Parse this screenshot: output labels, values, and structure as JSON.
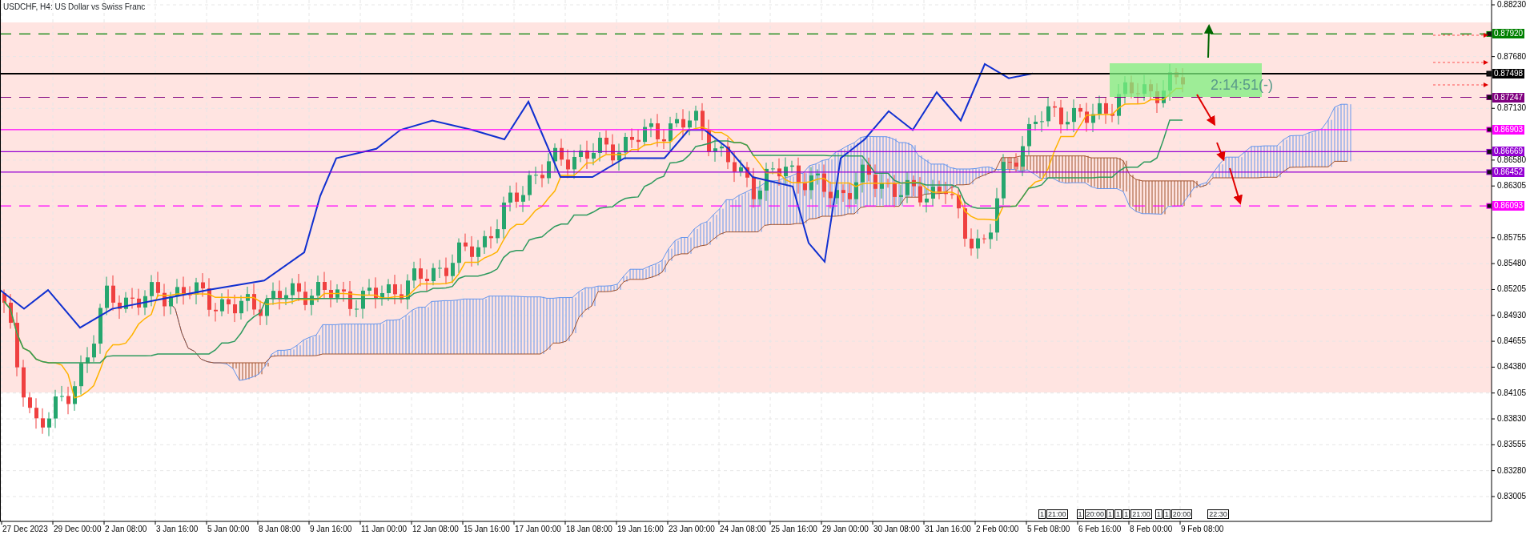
{
  "chart": {
    "title": "USDCHF, H4:  US Dollar vs Swiss Franc",
    "price_axis": [
      "0.88230",
      "0.87680",
      "0.87130",
      "0.86580",
      "0.86305",
      "0.85755",
      "0.85480",
      "0.85205",
      "0.84930",
      "0.84655",
      "0.84380",
      "0.84105",
      "0.83830",
      "0.83555",
      "0.83280",
      "0.83005"
    ],
    "time_axis": [
      "27 Dec 2023",
      "29 Dec 00:00",
      "2 Jan 08:00",
      "3 Jan 16:00",
      "5 Jan 00:00",
      "8 Jan 08:00",
      "9 Jan 16:00",
      "11 Jan 00:00",
      "12 Jan 08:00",
      "15 Jan 16:00",
      "17 Jan 00:00",
      "18 Jan 08:00",
      "19 Jan 16:00",
      "23 Jan 00:00",
      "24 Jan 08:00",
      "25 Jan 16:00",
      "29 Jan 00:00",
      "30 Jan 08:00",
      "31 Jan 16:00",
      "2 Feb 00:00",
      "5 Feb 08:00",
      "6 Feb 16:00",
      "8 Feb 00:00",
      "9 Feb 08:00"
    ],
    "levels": [
      {
        "price": "0.87920",
        "color": "#008000",
        "kind": "dashed"
      },
      {
        "price": "0.87498",
        "color": "#000000",
        "kind": "solid"
      },
      {
        "price": "0.87247",
        "color": "#800080",
        "kind": "dashed"
      },
      {
        "price": "0.86903",
        "color": "#ff00ff",
        "kind": "solid"
      },
      {
        "price": "0.86669",
        "color": "#9400d3",
        "kind": "solid"
      },
      {
        "price": "0.86452",
        "color": "#9400d3",
        "kind": "solid"
      },
      {
        "price": "0.86093",
        "color": "#ff00ff",
        "kind": "dashed"
      }
    ],
    "countdown": "2:14:51(-)",
    "session_markers": [
      "1",
      "21:00",
      "1",
      "20:00",
      "1",
      "1",
      "1",
      "21:00",
      "1",
      "1",
      "20:00",
      "22:30"
    ]
  }
}
